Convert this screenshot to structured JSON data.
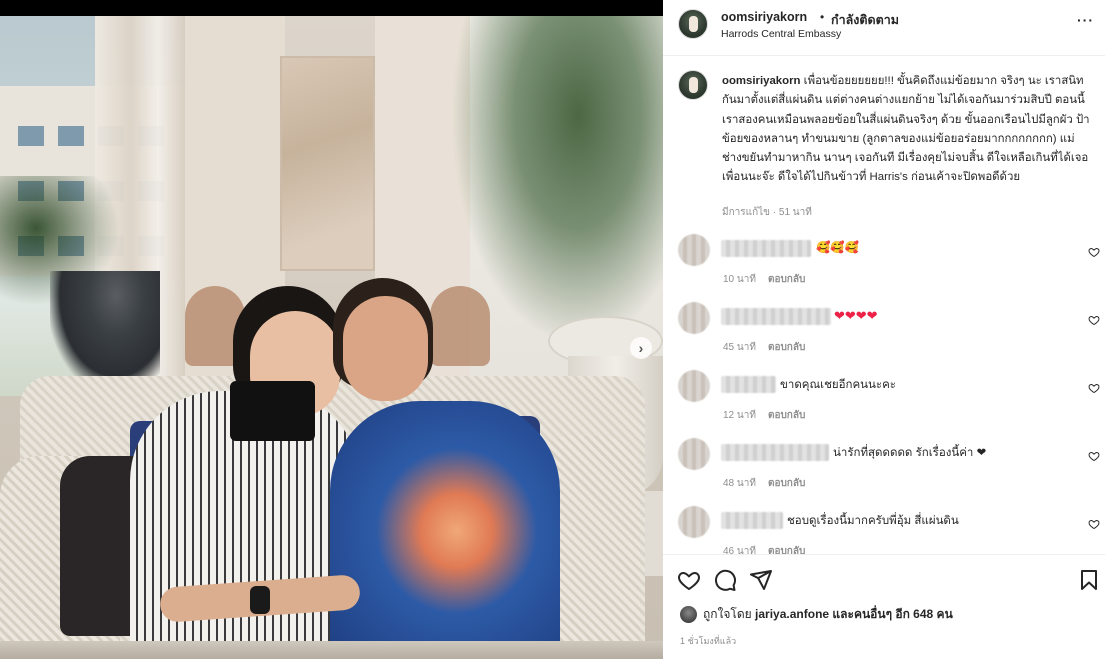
{
  "post": {
    "photo_alt": "Two women smiling and hugging on a wicker sofa",
    "next_arrow": "›"
  },
  "header": {
    "username": "oomsiriyakorn",
    "dot": "•",
    "follow_label": "กำลังติดตาม",
    "location": "Harrods Central Embassy",
    "more_icon": "···"
  },
  "caption": {
    "username": "oomsiriyakorn",
    "text": "เพื่อนข้อยยยยยย!!! ขั้นคิดถึงแม่ข้อยมาก จริงๆ นะ เราสนิทกันมาตั้งแต่สี่แผ่นดิน แต่ต่างคนต่างแยกย้าย ไม่ได้เจอกันมาร่วมสิบปี ตอนนี้เราสองคนเหมือนพลอยข้อยในสี่แผ่นดินจริงๆ ด้วย ขั้นออกเรือนไปมีลูกผัว ป้าข้อยของหลานๆ ทำขนมขาย (ลูกตาลของแม่ข้อยอร่อยมากกกกกกกก) แม่ช่างขยันทำมาหากิน นานๆ เจอกันที มีเรื่องคุยไม่จบสิ้น ดีใจเหลือเกินที่ได้เจอเพื่อนนะจ๊ะ ดีใจได้ไปกินข้าวที่ Harris's ก่อนเค้าจะปิดพอดีด้วย",
    "meta": "มีการแก้ไข · 51 นาที"
  },
  "comments": [
    {
      "text": "🥰🥰🥰",
      "time": "10 นาที",
      "reply": "ตอบกลับ"
    },
    {
      "text": "❤❤❤❤",
      "time": "45 นาที",
      "reply": "ตอบกลับ"
    },
    {
      "text": "ขาดคุณเชยอีกคนนะคะ",
      "time": "12 นาที",
      "reply": "ตอบกลับ"
    },
    {
      "text": "น่ารักที่สุดดดดด รักเรื่องนี้ค่า ❤",
      "time": "48 นาที",
      "reply": "ตอบกลับ"
    },
    {
      "text": "ชอบดูเรื่องนี้มากครับพี่อุ้ม สี่แผ่นดิน",
      "time": "46 นาที",
      "reply": "ตอบกลับ"
    }
  ],
  "actions": {
    "liked_by_prefix": "ถูกใจโดย",
    "liked_by_user": "jariya.anfone",
    "liked_by_suffix": "และคนอื่นๆ อีก 648 คน",
    "time": "1 ชั่วโมงที่แล้ว"
  },
  "colors": {
    "heart": "#ed2147",
    "muted": "#8e8e8e",
    "text": "#262626"
  }
}
